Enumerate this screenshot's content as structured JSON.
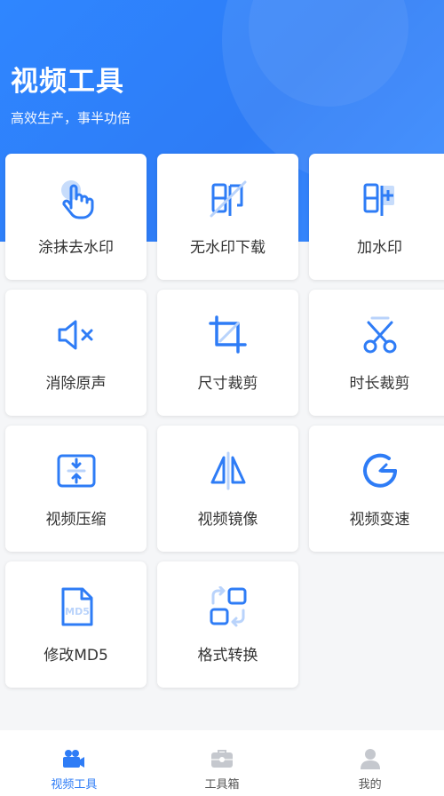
{
  "header": {
    "title": "视频工具",
    "subtitle": "高效生产，事半功倍"
  },
  "accent_color": "#2e7cf6",
  "tools": [
    {
      "label": "涂抹去水印",
      "icon": "finger-touch-icon"
    },
    {
      "label": "无水印下载",
      "icon": "no-watermark-icon"
    },
    {
      "label": "加水印",
      "icon": "add-watermark-icon"
    },
    {
      "label": "消除原声",
      "icon": "mute-speaker-icon"
    },
    {
      "label": "尺寸裁剪",
      "icon": "crop-icon"
    },
    {
      "label": "时长裁剪",
      "icon": "scissors-icon"
    },
    {
      "label": "视频压缩",
      "icon": "compress-icon"
    },
    {
      "label": "视频镜像",
      "icon": "mirror-icon"
    },
    {
      "label": "视频变速",
      "icon": "speed-gauge-icon"
    },
    {
      "label": "修改MD5",
      "icon": "md5-file-icon"
    },
    {
      "label": "格式转换",
      "icon": "format-convert-icon"
    }
  ],
  "tabbar": {
    "items": [
      {
        "label": "视频工具",
        "icon": "video-camera-icon",
        "active": true
      },
      {
        "label": "工具箱",
        "icon": "toolbox-icon",
        "active": false
      },
      {
        "label": "我的",
        "icon": "user-icon",
        "active": false
      }
    ]
  }
}
